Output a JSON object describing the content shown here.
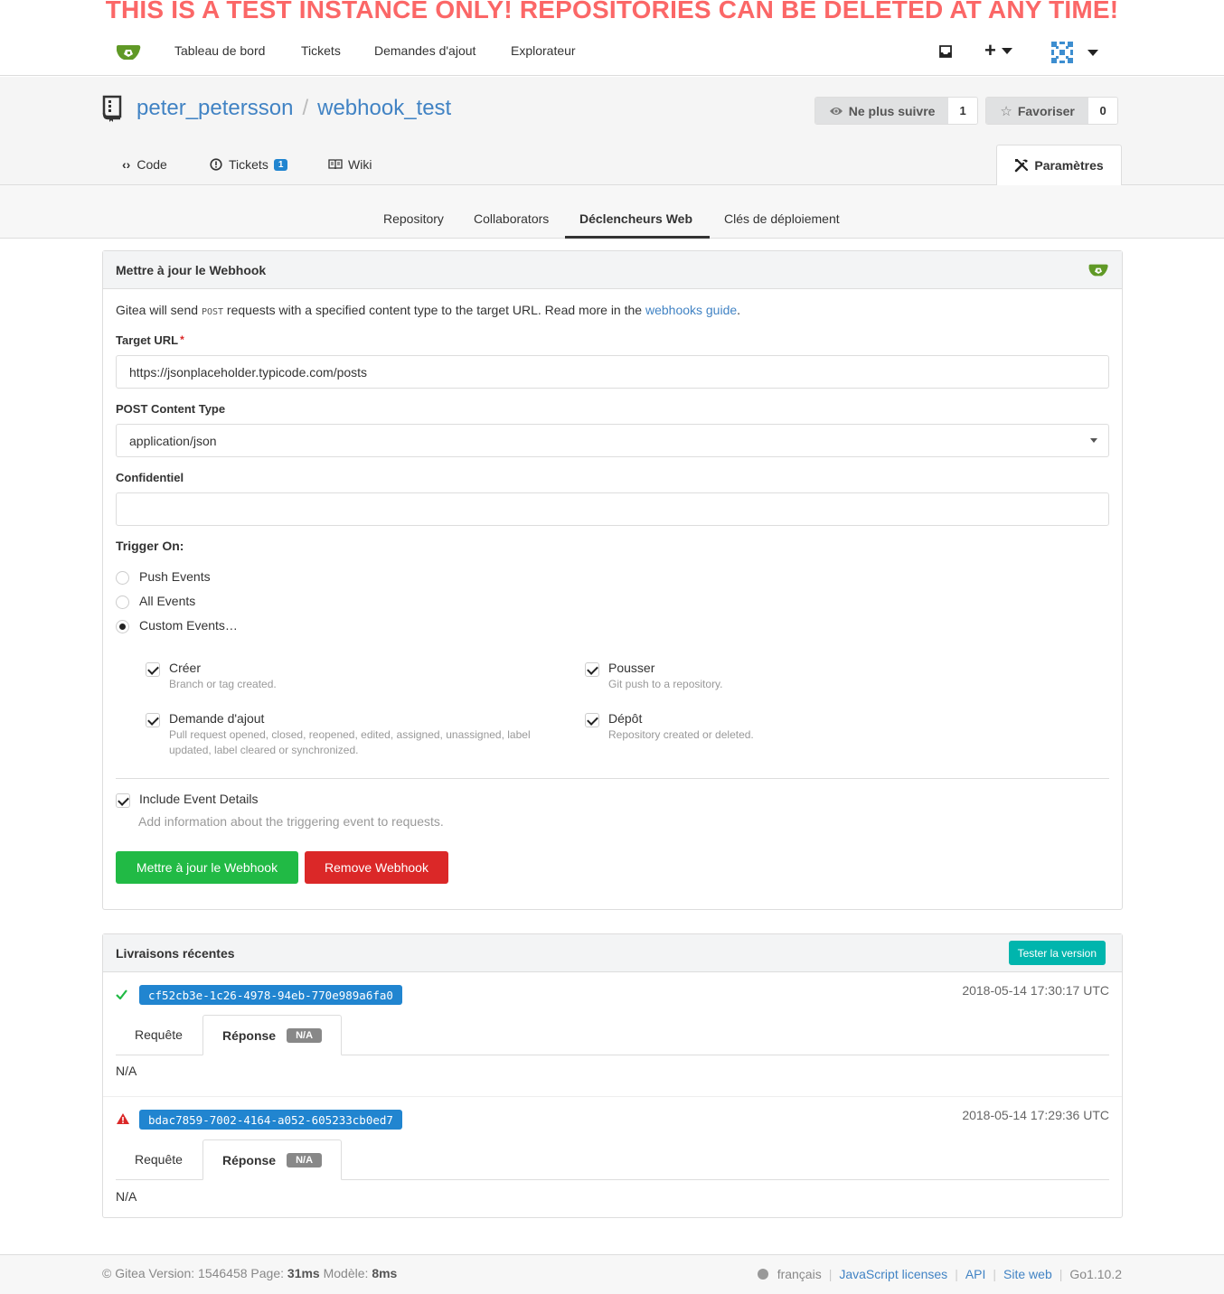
{
  "banner": "THIS IS A TEST INSTANCE ONLY! REPOSITORIES CAN BE DELETED AT ANY TIME!",
  "nav": {
    "dashboard": "Tableau de bord",
    "issues": "Tickets",
    "pulls": "Demandes d'ajout",
    "explore": "Explorateur"
  },
  "repo": {
    "owner": "peter_petersson",
    "name": "webhook_test",
    "watch_label": "Ne plus suivre",
    "watch_count": "1",
    "star_label": "Favoriser",
    "star_count": "0",
    "tabs": {
      "code": "Code",
      "issues": "Tickets",
      "issues_count": "1",
      "wiki": "Wiki",
      "settings": "Paramètres"
    }
  },
  "settings_tabs": {
    "repository": "Repository",
    "collaborators": "Collaborators",
    "webhooks": "Déclencheurs Web",
    "deploy_keys": "Clés de déploiement"
  },
  "webhook": {
    "header": "Mettre à jour le Webhook",
    "desc_1": "Gitea will send",
    "desc_code": "POST",
    "desc_2": "requests with a specified content type to the target URL. Read more in the",
    "desc_link": "webhooks guide",
    "desc_end": ".",
    "target_url_label": "Target URL",
    "target_url_value": "https://jsonplaceholder.typicode.com/posts",
    "content_type_label": "POST Content Type",
    "content_type_value": "application/json",
    "secret_label": "Confidentiel",
    "secret_value": "",
    "trigger_label": "Trigger On:",
    "trigger_options": [
      "Push Events",
      "All Events",
      "Custom Events…"
    ],
    "trigger_selected": "Custom Events…",
    "events": [
      {
        "title": "Créer",
        "desc": "Branch or tag created."
      },
      {
        "title": "Pousser",
        "desc": "Git push to a repository."
      },
      {
        "title": "Demande d'ajout",
        "desc": "Pull request opened, closed, reopened, edited, assigned, unassigned, label updated, label cleared or synchronized."
      },
      {
        "title": "Dépôt",
        "desc": "Repository created or deleted."
      }
    ],
    "include_details_label": "Include Event Details",
    "include_details_desc": "Add information about the triggering event to requests.",
    "update_button": "Mettre à jour le Webhook",
    "remove_button": "Remove Webhook"
  },
  "deliveries": {
    "header": "Livraisons récentes",
    "test_button": "Tester la version",
    "items": [
      {
        "uuid": "cf52cb3e-1c26-4978-94eb-770e989a6fa0",
        "status": "success",
        "time": "2018-05-14 17:30:17 UTC",
        "request_tab": "Requête",
        "response_tab": "Réponse",
        "badge": "N/A",
        "body": "N/A"
      },
      {
        "uuid": "bdac7859-7002-4164-a052-605233cb0ed7",
        "status": "warning",
        "time": "2018-05-14 17:29:36 UTC",
        "request_tab": "Requête",
        "response_tab": "Réponse",
        "badge": "N/A",
        "body": "N/A"
      }
    ]
  },
  "footer": {
    "copy": "© Gitea Version: 1546458 Page:",
    "page_time": "31ms",
    "template_label": "Modèle:",
    "template_time": "8ms",
    "language": "français",
    "js_licenses": "JavaScript licenses",
    "api": "API",
    "website": "Site web",
    "go_version": "Go1.10.2"
  },
  "colors": {
    "accent": "#4183c4",
    "success": "#21ba45",
    "danger": "#db2828",
    "teal": "#00b5ad",
    "banner": "#fb6767"
  }
}
